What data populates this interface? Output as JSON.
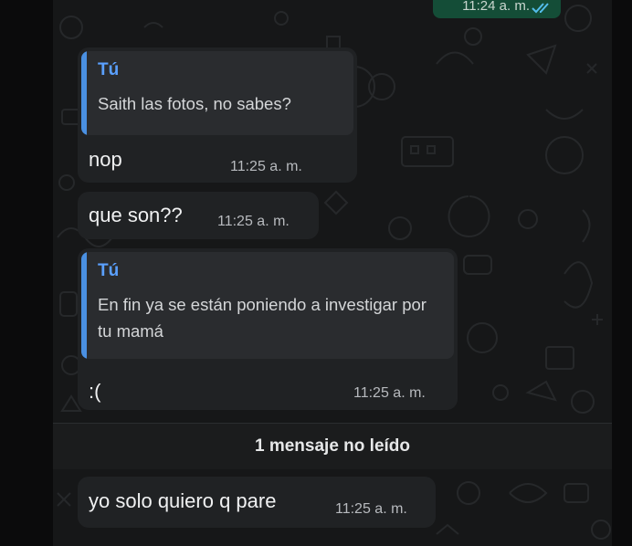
{
  "colors": {
    "chat_background": "#161718",
    "incoming_bubble": "#202224",
    "outgoing_bubble": "#144d37",
    "quote_accent": "#4a90e2",
    "quote_author": "#5aa0ff"
  },
  "outgoing_partial": {
    "time": "11:24 a. m.",
    "status_icon": "double-check-read-icon"
  },
  "messages": [
    {
      "quote_author": "Tú",
      "quote_text": "Saith las fotos, no sabes?",
      "text": "nop",
      "time": "11:25 a. m."
    },
    {
      "text": "que son??",
      "time": "11:25 a. m."
    },
    {
      "quote_author": "Tú",
      "quote_text": "En fin ya se están poniendo a investigar por tu mamá",
      "text": ":(",
      "time": "11:25 a. m."
    }
  ],
  "unread_divider": "1 mensaje no leído",
  "unread_messages": [
    {
      "text": "yo solo quiero q pare",
      "time": "11:25 a. m."
    }
  ]
}
